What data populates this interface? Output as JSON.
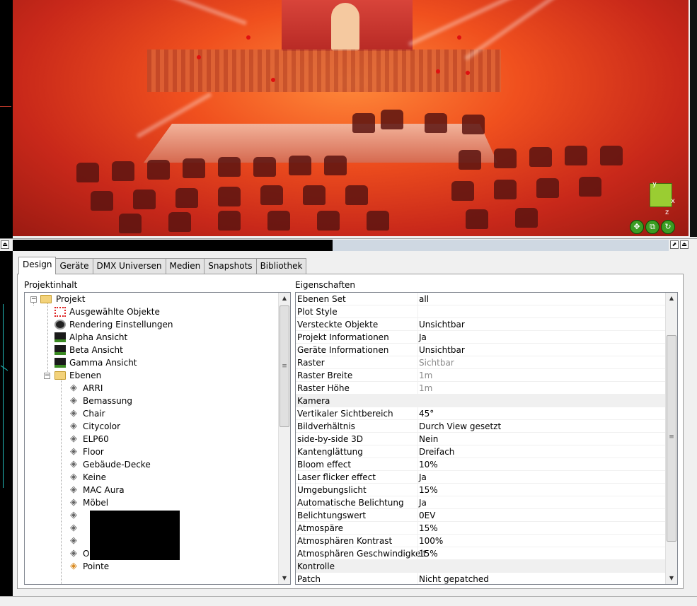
{
  "viewport": {
    "gizmo_axes": {
      "x": "x",
      "y": "y",
      "z": "z"
    },
    "gizmo_buttons": [
      "move-icon",
      "layers-icon",
      "rotate-icon"
    ]
  },
  "splitbar": {
    "left_icon": "dock-up-icon",
    "right_icons": [
      "pin-icon",
      "dock-up-icon"
    ]
  },
  "tabs": [
    {
      "label": "Design"
    },
    {
      "label": "Geräte"
    },
    {
      "label": "DMX Universen"
    },
    {
      "label": "Medien"
    },
    {
      "label": "Snapshots"
    },
    {
      "label": "Bibliothek"
    }
  ],
  "project_panel": {
    "title": "Projektinhalt",
    "root": "Projekt",
    "items": [
      {
        "label": "Ausgewählte Objekte",
        "icon": "selection-icon"
      },
      {
        "label": "Rendering Einstellungen",
        "icon": "camera-lens-icon"
      },
      {
        "label": "Alpha Ansicht",
        "icon": "view-icon"
      },
      {
        "label": "Beta Ansicht",
        "icon": "view-icon"
      },
      {
        "label": "Gamma Ansicht",
        "icon": "view-icon"
      }
    ],
    "layers_folder": "Ebenen",
    "layers": [
      "ARRI",
      "Bemassung",
      "Chair",
      "Citycolor",
      "ELP60",
      "Floor",
      "Gebäude-Decke",
      "Keine",
      "MAC Aura",
      "Möbel",
      "",
      "",
      "",
      "Opera",
      "Pointe"
    ]
  },
  "properties_panel": {
    "title": "Eigenschaften",
    "rows": [
      {
        "key": "Ebenen Set",
        "value": "all"
      },
      {
        "key": "Plot Style",
        "value": ""
      },
      {
        "key": "Versteckte Objekte",
        "value": "Unsichtbar"
      },
      {
        "key": "Projekt Informationen",
        "value": "Ja"
      },
      {
        "key": "Geräte Informationen",
        "value": "Unsichtbar"
      },
      {
        "key": "Raster",
        "value": "Sichtbar",
        "grey": true
      },
      {
        "key": "Raster Breite",
        "value": "1m",
        "grey": true
      },
      {
        "key": "Raster Höhe",
        "value": "1m",
        "grey": true
      },
      {
        "key": "Kamera",
        "value": "",
        "category": true
      },
      {
        "key": "Vertikaler Sichtbereich",
        "value": "45°"
      },
      {
        "key": "Bildverhältnis",
        "value": "Durch View gesetzt"
      },
      {
        "key": "side-by-side 3D",
        "value": "Nein"
      },
      {
        "key": "Kantenglättung",
        "value": "Dreifach"
      },
      {
        "key": "Bloom effect",
        "value": "10%"
      },
      {
        "key": "Laser flicker effect",
        "value": "Ja"
      },
      {
        "key": "Umgebungslicht",
        "value": "15%"
      },
      {
        "key": "Automatische Belichtung",
        "value": "Ja"
      },
      {
        "key": "Belichtungswert",
        "value": "0EV"
      },
      {
        "key": "Atmospäre",
        "value": "15%"
      },
      {
        "key": "Atmosphären Kontrast",
        "value": "100%"
      },
      {
        "key": "Atmosphären Geschwindigkeit",
        "value": "15%"
      },
      {
        "key": "Kontrolle",
        "value": "",
        "category": true
      },
      {
        "key": "Patch",
        "value": "Nicht gepatched"
      }
    ]
  }
}
